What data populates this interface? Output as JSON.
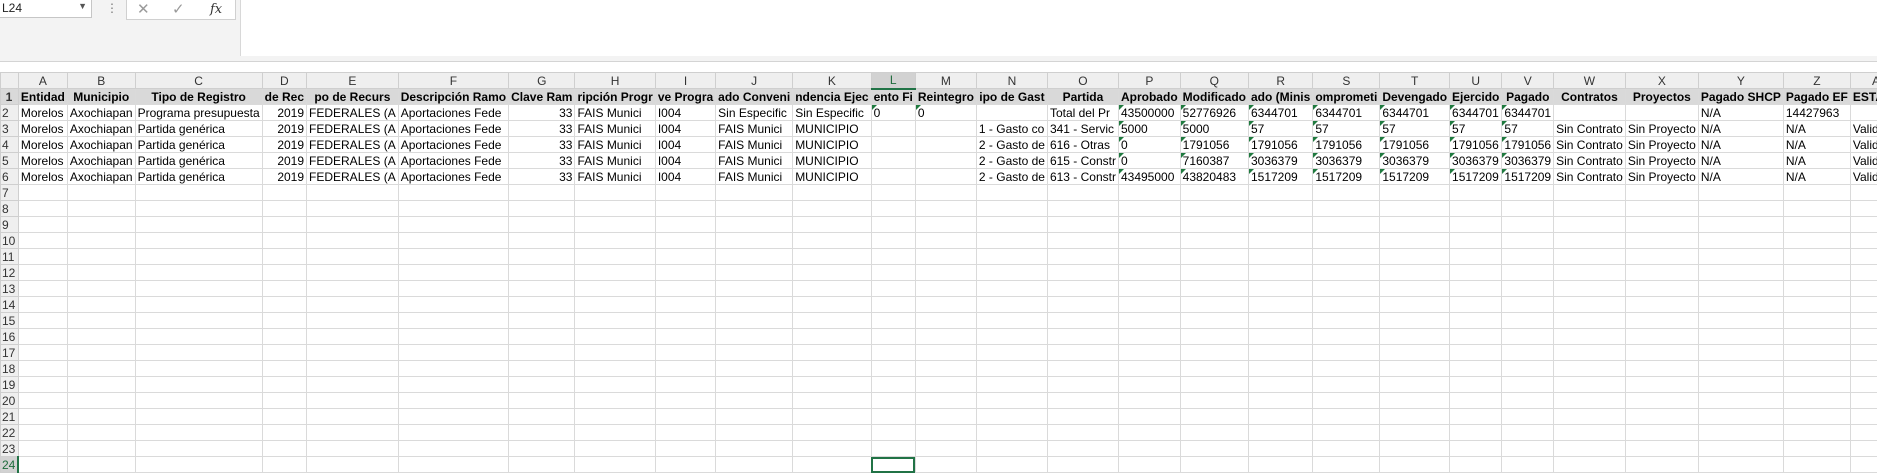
{
  "name_box": {
    "value": "L24"
  },
  "formula_bar": {
    "cancel_glyph": "✕",
    "enter_glyph": "✓",
    "fx_glyph": "fx",
    "value": ""
  },
  "selected_cell": {
    "column": "L",
    "row": "24"
  },
  "column_letters": [
    "A",
    "B",
    "C",
    "D",
    "E",
    "F",
    "G",
    "H",
    "I",
    "J",
    "K",
    "L",
    "M",
    "N",
    "O",
    "P",
    "Q",
    "R",
    "S",
    "T",
    "U",
    "V",
    "W",
    "X",
    "Y",
    "Z",
    "AA"
  ],
  "row_numbers": [
    "1",
    "2",
    "3",
    "4",
    "5",
    "6",
    "7",
    "8",
    "9",
    "10",
    "11",
    "12",
    "13",
    "14",
    "15",
    "16",
    "17",
    "18",
    "19",
    "20",
    "21",
    "22",
    "23",
    "24"
  ],
  "header_row": [
    "Entidad",
    "Municipio",
    "Tipo de Registro",
    "de Rec",
    "po de Recurs",
    "Descripción Ramo",
    "Clave Ram",
    "ripción Progr",
    "ve Progra",
    "ado Conveni",
    "ndencia Ejec",
    "ento Fi",
    "Reintegro",
    "ipo de Gast",
    "Partida",
    "Aprobado",
    "Modificado",
    "ado (Minis",
    "omprometi",
    "Devengado",
    "Ejercido",
    "Pagado",
    "Contratos",
    "Proyectos",
    "Pagado SHCP",
    "Pagado EF",
    "ESTATUS"
  ],
  "data_rows": [
    [
      "Morelos",
      "Axochiapan",
      "Programa presupuesta",
      "2019",
      "FEDERALES (A",
      "Aportaciones Fede",
      "33",
      "FAIS Munici",
      "I004",
      "Sin Especific",
      "Sin Especific",
      "0",
      "0",
      "",
      "Total del Pr",
      "43500000",
      "52776926",
      "6344701",
      "6344701",
      "6344701",
      "6344701",
      "6344701",
      "",
      "",
      "N/A",
      "14427963",
      ""
    ],
    [
      "Morelos",
      "Axochiapan",
      "Partida genérica",
      "2019",
      "FEDERALES (A",
      "Aportaciones Fede",
      "33",
      "FAIS Munici",
      "I004",
      "FAIS Munici",
      "MUNICIPIO",
      "",
      "",
      "1 - Gasto co",
      "341 - Servic",
      "5000",
      "5000",
      "57",
      "57",
      "57",
      "57",
      "57",
      "Sin Contrato",
      "Sin Proyecto",
      "N/A",
      "N/A",
      "Validado"
    ],
    [
      "Morelos",
      "Axochiapan",
      "Partida genérica",
      "2019",
      "FEDERALES (A",
      "Aportaciones Fede",
      "33",
      "FAIS Munici",
      "I004",
      "FAIS Munici",
      "MUNICIPIO",
      "",
      "",
      "2 - Gasto de",
      "616 - Otras",
      "0",
      "1791056",
      "1791056",
      "1791056",
      "1791056",
      "1791056",
      "1791056",
      "Sin Contrato",
      "Sin Proyecto",
      "N/A",
      "N/A",
      "Validado"
    ],
    [
      "Morelos",
      "Axochiapan",
      "Partida genérica",
      "2019",
      "FEDERALES (A",
      "Aportaciones Fede",
      "33",
      "FAIS Munici",
      "I004",
      "FAIS Munici",
      "MUNICIPIO",
      "",
      "",
      "2 - Gasto de",
      "615 - Constr",
      "0",
      "7160387",
      "3036379",
      "3036379",
      "3036379",
      "3036379",
      "3036379",
      "Sin Contrato",
      "Sin Proyecto",
      "N/A",
      "N/A",
      "Validado"
    ],
    [
      "Morelos",
      "Axochiapan",
      "Partida genérica",
      "2019",
      "FEDERALES (A",
      "Aportaciones Fede",
      "33",
      "FAIS Munici",
      "I004",
      "FAIS Munici",
      "MUNICIPIO",
      "",
      "",
      "2 - Gasto de",
      "613 - Constr",
      "43495000",
      "43820483",
      "1517209",
      "1517209",
      "1517209",
      "1517209",
      "1517209",
      "Sin Contrato",
      "Sin Proyecto",
      "N/A",
      "N/A",
      "Validado"
    ]
  ]
}
